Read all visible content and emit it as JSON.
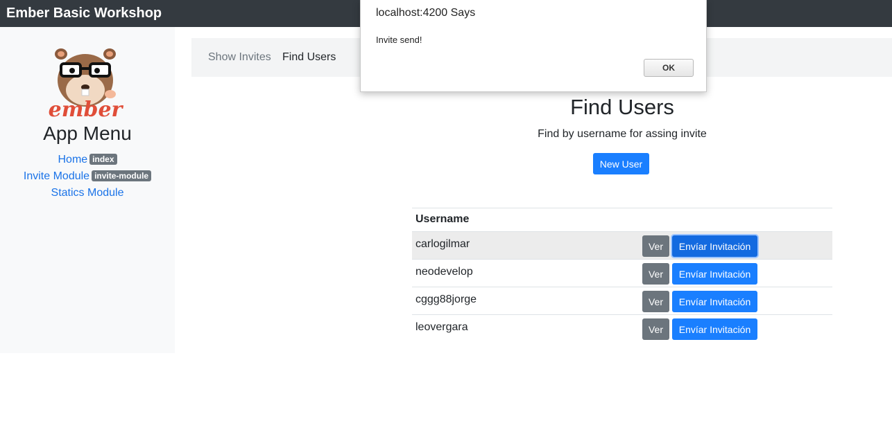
{
  "navbar": {
    "brand": "Ember Basic Workshop"
  },
  "sidebar": {
    "title": "App Menu",
    "logo_text": "ember",
    "items": [
      {
        "label": "Home",
        "badge": "index"
      },
      {
        "label": "Invite Module",
        "badge": "invite-module"
      },
      {
        "label": "Statics Module"
      }
    ]
  },
  "subnav": {
    "tabs": [
      {
        "label": "Show Invites"
      },
      {
        "label": "Find Users"
      }
    ]
  },
  "main": {
    "title": "Find Users",
    "subtitle": "Find by username for assing invite",
    "new_user_label": "New User",
    "table": {
      "header": "Username",
      "ver_label": "Ver",
      "invite_label": "Envíar Invitación",
      "rows": [
        {
          "username": "carlogilmar"
        },
        {
          "username": "neodevelop"
        },
        {
          "username": "cggg88jorge"
        },
        {
          "username": "leovergara"
        }
      ]
    }
  },
  "dialog": {
    "title": "localhost:4200 Says",
    "message": "Invite send!",
    "ok_label": "OK"
  },
  "colors": {
    "navbar": "#343a40",
    "primary": "#1a7fff",
    "secondary": "#6c757d",
    "link": "#1a73e8"
  }
}
